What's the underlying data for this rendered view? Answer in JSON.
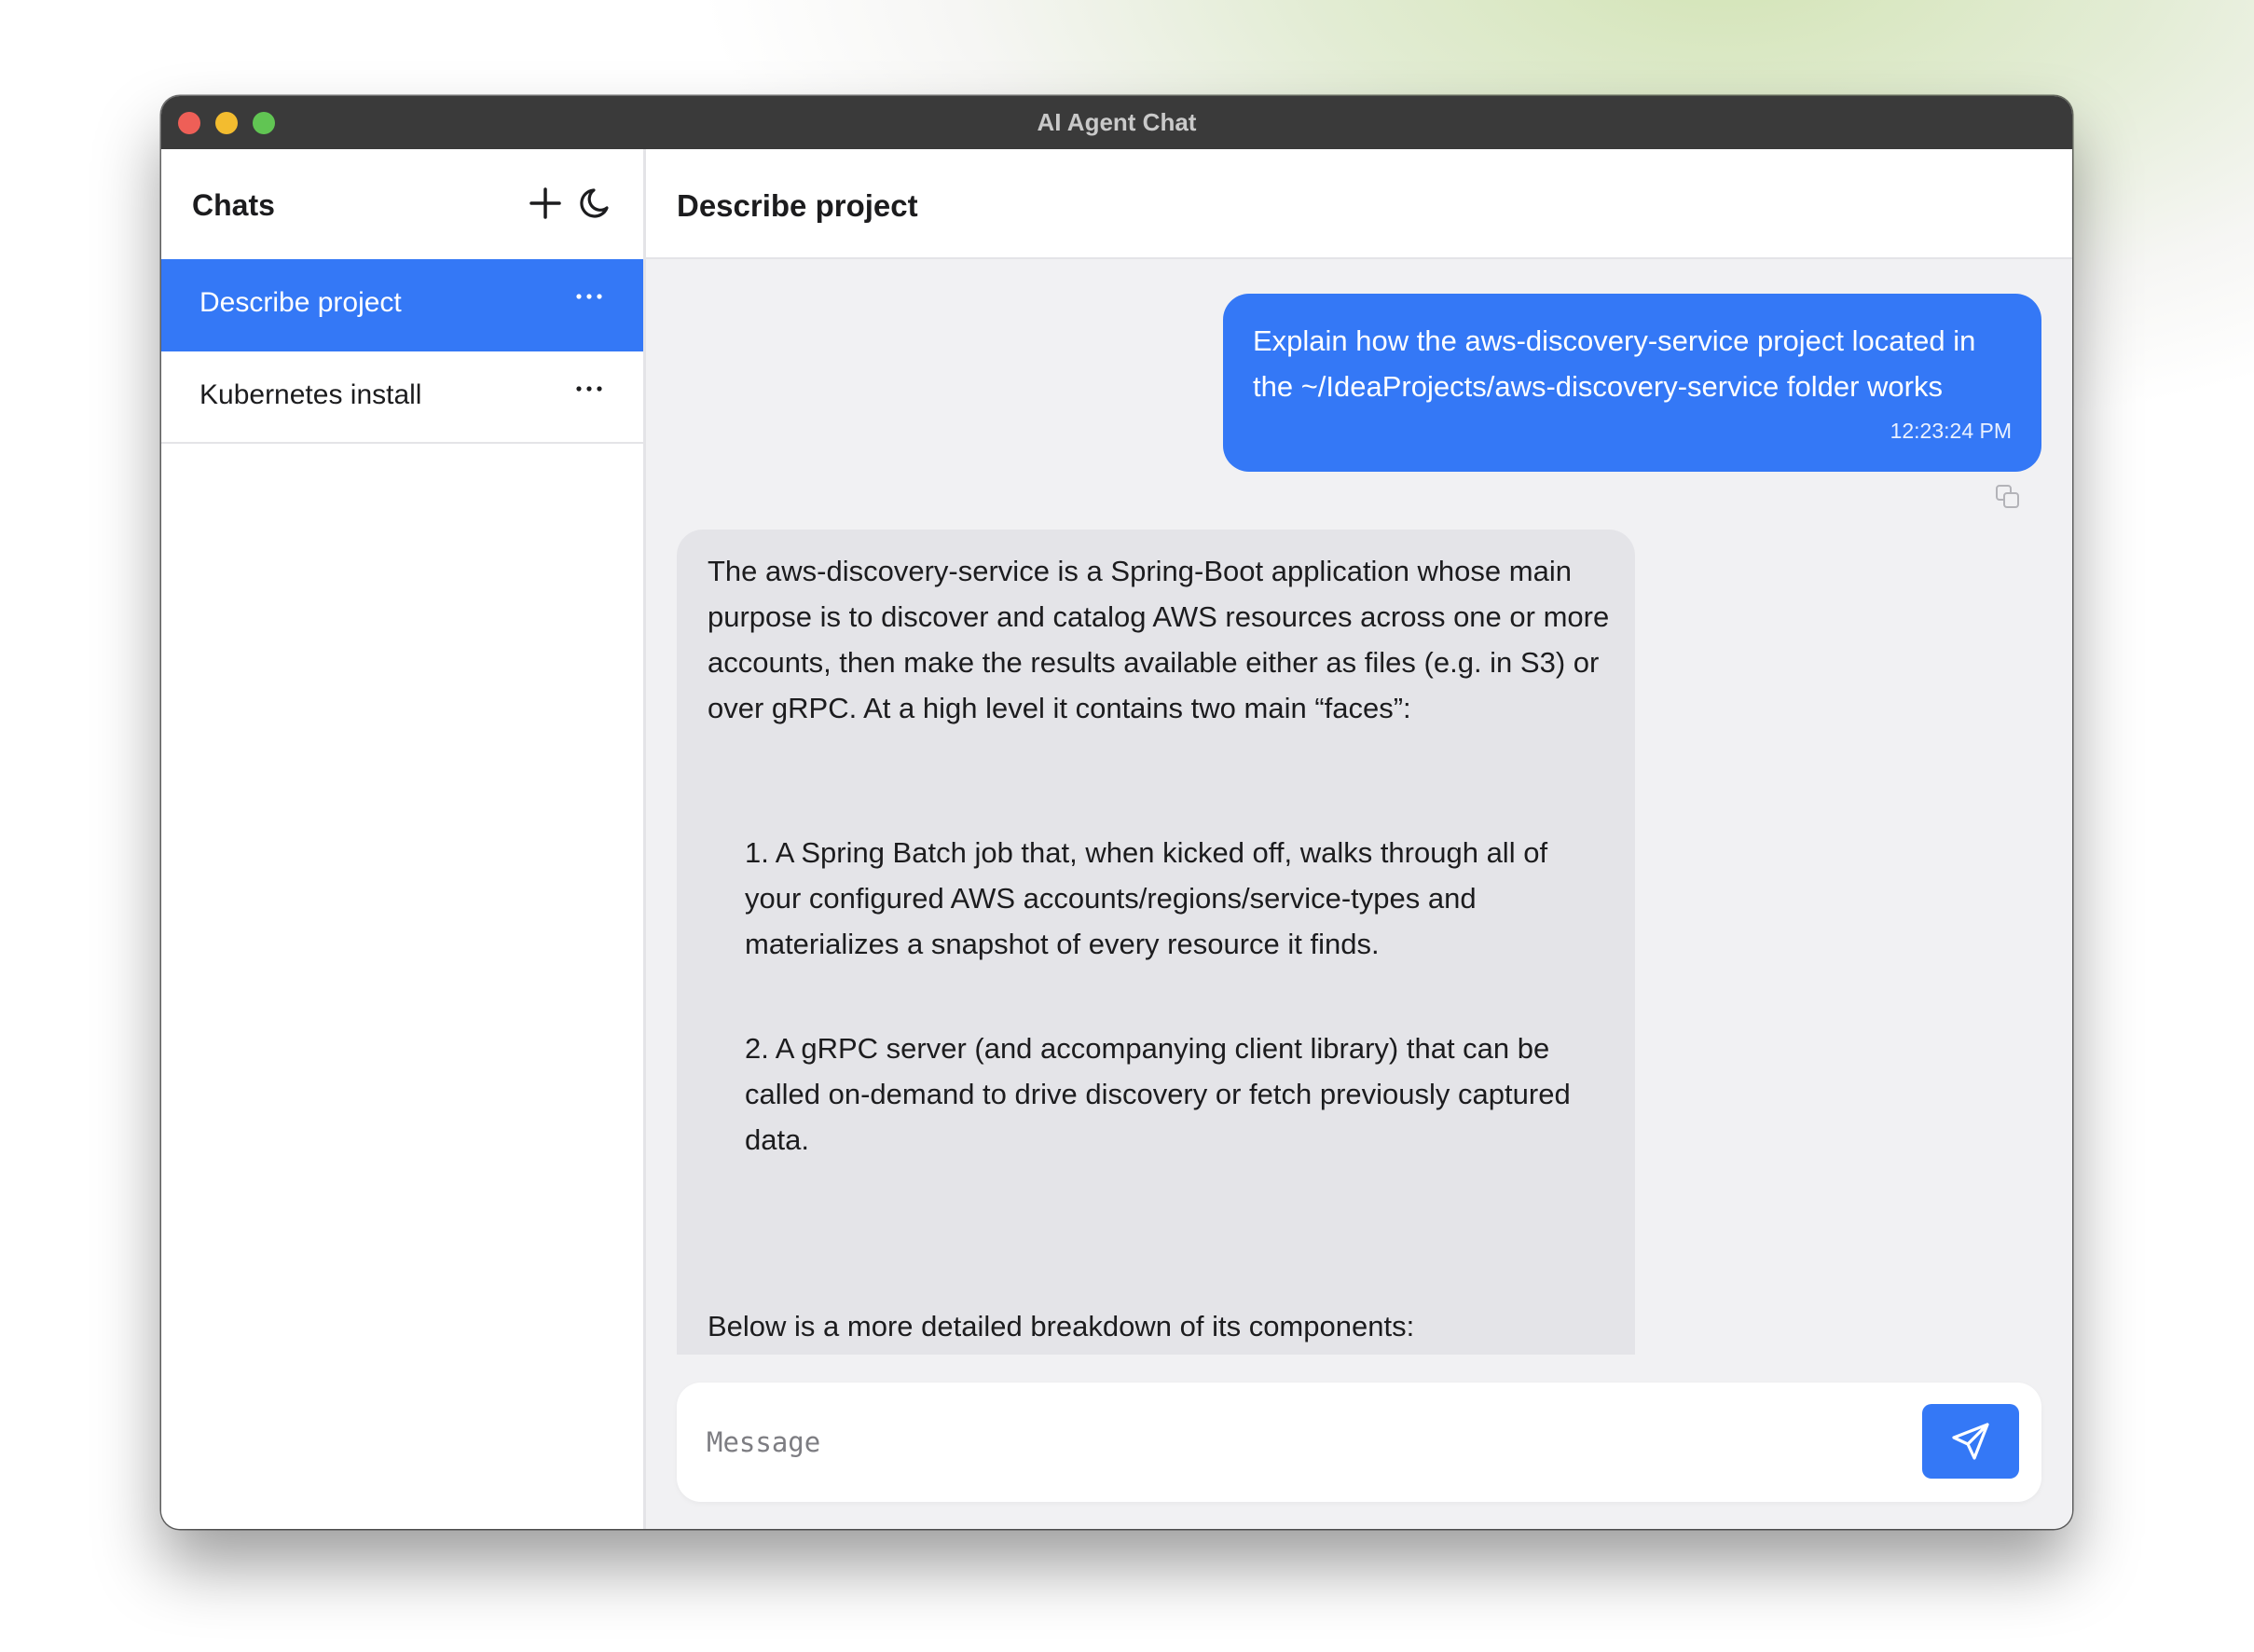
{
  "window": {
    "title": "AI Agent Chat"
  },
  "sidebar": {
    "title": "Chats",
    "new_chat_icon": "plus-icon",
    "theme_toggle_icon": "moon-icon",
    "items": [
      {
        "label": "Describe project",
        "active": true
      },
      {
        "label": "Kubernetes install",
        "active": false
      }
    ]
  },
  "chat": {
    "title": "Describe project",
    "messages": [
      {
        "role": "user",
        "text": "Explain how the aws-discovery-service project located in the ~/IdeaProjects/aws-discovery-service folder works",
        "time": "12:23:24 PM"
      },
      {
        "role": "assistant",
        "intro": "The aws-discovery-service is a Spring-Boot application whose main purpose is to discover and catalog AWS resources across one or more accounts, then make the results available either as files (e.g. in S3) or over gRPC.  At a high level it contains two main “faces”:",
        "items": [
          "1. A Spring Batch job that, when kicked off, walks through all of your configured AWS accounts/regions/service-types and materializes a snapshot of every resource it finds.",
          "2. A gRPC server (and accompanying client library) that can be called on-demand to drive discovery or fetch previously captured data."
        ],
        "outro": "Below is a more detailed breakdown of its components:"
      }
    ]
  },
  "composer": {
    "placeholder": "Message",
    "send_icon": "send-icon"
  },
  "colors": {
    "accent": "#3478f6",
    "assistant_bubble": "#e4e4e8",
    "main_bg": "#f1f1f3"
  }
}
